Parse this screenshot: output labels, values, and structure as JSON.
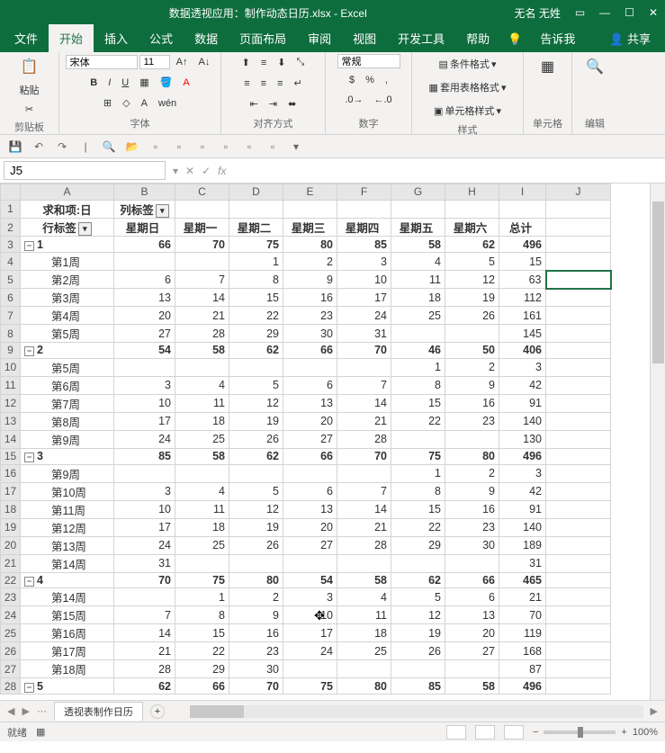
{
  "title": {
    "doc": "数据透视应用：制作动态日历.xlsx",
    "app": "Excel",
    "user": "无名 无姓"
  },
  "tabs": {
    "file": "文件",
    "home": "开始",
    "insert": "插入",
    "formulas": "公式",
    "data": "数据",
    "layout": "页面布局",
    "review": "审阅",
    "view": "视图",
    "dev": "开发工具",
    "help": "帮助",
    "tellme": "告诉我",
    "share": "共享"
  },
  "ribbon": {
    "clipboard": "剪贴板",
    "paste": "粘贴",
    "font": "字体",
    "align": "对齐方式",
    "number": "数字",
    "styles": "样式",
    "cells": "单元格",
    "editing": "编辑",
    "fontname": "宋体",
    "fontsize": "11",
    "numfmt": "常规",
    "condfmt": "条件格式",
    "tblfmt": "套用表格格式",
    "cellstyle": "单元格样式"
  },
  "namebox": "J5",
  "fx": "",
  "colheads": [
    "A",
    "B",
    "C",
    "D",
    "E",
    "F",
    "G",
    "H",
    "I",
    "J"
  ],
  "pivot": {
    "measure": "求和项:日",
    "collabel": "列标签",
    "rowlabel": "行标签",
    "days": [
      "星期日",
      "星期一",
      "星期二",
      "星期三",
      "星期四",
      "星期五",
      "星期六"
    ],
    "total": "总计"
  },
  "rows": [
    {
      "r": 3,
      "type": "g",
      "lbl": "1",
      "v": [
        66,
        70,
        75,
        80,
        85,
        58,
        62,
        496
      ]
    },
    {
      "r": 4,
      "type": "d",
      "lbl": "第1周",
      "v": [
        "",
        "",
        1,
        2,
        3,
        4,
        5,
        15
      ]
    },
    {
      "r": 5,
      "type": "d",
      "lbl": "第2周",
      "v": [
        6,
        7,
        8,
        9,
        10,
        11,
        12,
        63
      ],
      "sel": true
    },
    {
      "r": 6,
      "type": "d",
      "lbl": "第3周",
      "v": [
        13,
        14,
        15,
        16,
        17,
        18,
        19,
        112
      ]
    },
    {
      "r": 7,
      "type": "d",
      "lbl": "第4周",
      "v": [
        20,
        21,
        22,
        23,
        24,
        25,
        26,
        161
      ]
    },
    {
      "r": 8,
      "type": "d",
      "lbl": "第5周",
      "v": [
        27,
        28,
        29,
        30,
        31,
        "",
        "",
        145
      ]
    },
    {
      "r": 9,
      "type": "g",
      "lbl": "2",
      "v": [
        54,
        58,
        62,
        66,
        70,
        46,
        50,
        406
      ]
    },
    {
      "r": 10,
      "type": "d",
      "lbl": "第5周",
      "v": [
        "",
        "",
        "",
        "",
        "",
        1,
        2,
        3
      ]
    },
    {
      "r": 11,
      "type": "d",
      "lbl": "第6周",
      "v": [
        3,
        4,
        5,
        6,
        7,
        8,
        9,
        42
      ]
    },
    {
      "r": 12,
      "type": "d",
      "lbl": "第7周",
      "v": [
        10,
        11,
        12,
        13,
        14,
        15,
        16,
        91
      ]
    },
    {
      "r": 13,
      "type": "d",
      "lbl": "第8周",
      "v": [
        17,
        18,
        19,
        20,
        21,
        22,
        23,
        140
      ]
    },
    {
      "r": 14,
      "type": "d",
      "lbl": "第9周",
      "v": [
        24,
        25,
        26,
        27,
        28,
        "",
        "",
        130
      ]
    },
    {
      "r": 15,
      "type": "g",
      "lbl": "3",
      "v": [
        85,
        58,
        62,
        66,
        70,
        75,
        80,
        496
      ]
    },
    {
      "r": 16,
      "type": "d",
      "lbl": "第9周",
      "v": [
        "",
        "",
        "",
        "",
        "",
        1,
        2,
        3
      ]
    },
    {
      "r": 17,
      "type": "d",
      "lbl": "第10周",
      "v": [
        3,
        4,
        5,
        6,
        7,
        8,
        9,
        42
      ]
    },
    {
      "r": 18,
      "type": "d",
      "lbl": "第11周",
      "v": [
        10,
        11,
        12,
        13,
        14,
        15,
        16,
        91
      ]
    },
    {
      "r": 19,
      "type": "d",
      "lbl": "第12周",
      "v": [
        17,
        18,
        19,
        20,
        21,
        22,
        23,
        140
      ]
    },
    {
      "r": 20,
      "type": "d",
      "lbl": "第13周",
      "v": [
        24,
        25,
        26,
        27,
        28,
        29,
        30,
        189
      ]
    },
    {
      "r": 21,
      "type": "d",
      "lbl": "第14周",
      "v": [
        31,
        "",
        "",
        "",
        "",
        "",
        "",
        31
      ]
    },
    {
      "r": 22,
      "type": "g",
      "lbl": "4",
      "v": [
        70,
        75,
        80,
        54,
        58,
        62,
        66,
        465
      ]
    },
    {
      "r": 23,
      "type": "d",
      "lbl": "第14周",
      "v": [
        "",
        1,
        2,
        3,
        4,
        5,
        6,
        21
      ]
    },
    {
      "r": 24,
      "type": "d",
      "lbl": "第15周",
      "v": [
        7,
        8,
        9,
        10,
        11,
        12,
        13,
        70
      ]
    },
    {
      "r": 25,
      "type": "d",
      "lbl": "第16周",
      "v": [
        14,
        15,
        16,
        17,
        18,
        19,
        20,
        119
      ]
    },
    {
      "r": 26,
      "type": "d",
      "lbl": "第17周",
      "v": [
        21,
        22,
        23,
        24,
        25,
        26,
        27,
        168
      ]
    },
    {
      "r": 27,
      "type": "d",
      "lbl": "第18周",
      "v": [
        28,
        29,
        30,
        "",
        "",
        "",
        "",
        87
      ]
    },
    {
      "r": 28,
      "type": "g",
      "lbl": "5",
      "v": [
        62,
        66,
        70,
        75,
        80,
        85,
        58,
        496
      ]
    }
  ],
  "sheettab": "透视表制作日历",
  "status": {
    "ready": "就绪",
    "zoom": "100%"
  }
}
